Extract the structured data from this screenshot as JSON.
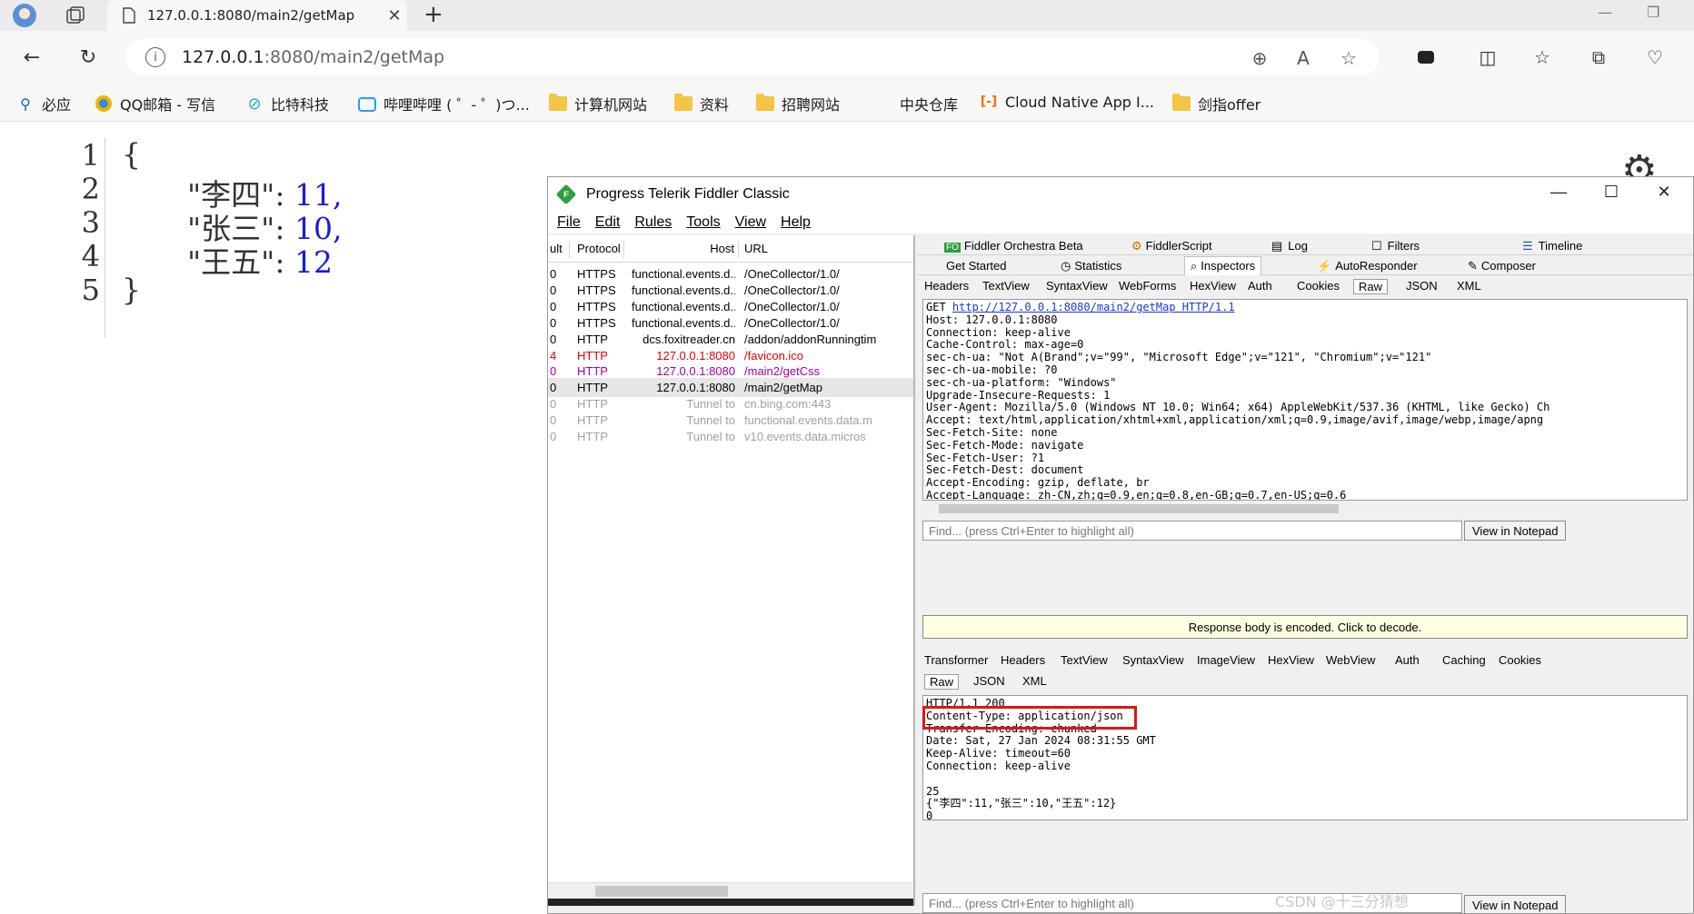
{
  "browser": {
    "tab_title": "127.0.0.1:8080/main2/getMap",
    "url_host": "127.0.0.1",
    "url_rest": ":8080/main2/getMap",
    "bookmarks": [
      "必应",
      "QQ邮箱 - 写信",
      "比特科技",
      "哔哩哔哩 ( ゜- ゜)つ...",
      "计算机网站",
      "资料",
      "招聘网站",
      "中央仓库",
      "Cloud Native App I...",
      "剑指offer"
    ]
  },
  "json_view": {
    "line_numbers": [
      "1",
      "2",
      "3",
      "4",
      "5"
    ],
    "open_brace": "{",
    "close_brace": "}",
    "entries": [
      {
        "key": "\"李四\":",
        "value": "11,"
      },
      {
        "key": "\"张三\":",
        "value": "10,"
      },
      {
        "key": "\"王五\":",
        "value": "12"
      }
    ]
  },
  "fiddler": {
    "title": "Progress Telerik Fiddler Classic",
    "menu": [
      "File",
      "Edit",
      "Rules",
      "Tools",
      "View",
      "Help"
    ],
    "session_headers": {
      "result": "ult",
      "protocol": "Protocol",
      "host": "Host",
      "url": "URL"
    },
    "sessions": [
      {
        "result": "0",
        "protocol": "HTTPS",
        "host": "functional.events.d...",
        "url": "/OneCollector/1.0/",
        "style": "normal"
      },
      {
        "result": "0",
        "protocol": "HTTPS",
        "host": "functional.events.d...",
        "url": "/OneCollector/1.0/",
        "style": "normal"
      },
      {
        "result": "0",
        "protocol": "HTTPS",
        "host": "functional.events.d...",
        "url": "/OneCollector/1.0/",
        "style": "normal"
      },
      {
        "result": "0",
        "protocol": "HTTPS",
        "host": "functional.events.d...",
        "url": "/OneCollector/1.0/",
        "style": "normal"
      },
      {
        "result": "0",
        "protocol": "HTTP",
        "host": "dcs.foxitreader.cn",
        "url": "/addon/addonRunningtim",
        "style": "normal"
      },
      {
        "result": "4",
        "protocol": "HTTP",
        "host": "127.0.0.1:8080",
        "url": "/favicon.ico",
        "style": "red"
      },
      {
        "result": "0",
        "protocol": "HTTP",
        "host": "127.0.0.1:8080",
        "url": "/main2/getCss",
        "style": "purple"
      },
      {
        "result": "0",
        "protocol": "HTTP",
        "host": "127.0.0.1:8080",
        "url": "/main2/getMap",
        "style": "selected"
      },
      {
        "result": "0",
        "protocol": "HTTP",
        "host": "Tunnel to",
        "url": "cn.bing.com:443",
        "style": "gray"
      },
      {
        "result": "0",
        "protocol": "HTTP",
        "host": "Tunnel to",
        "url": "functional.events.data.m",
        "style": "gray"
      },
      {
        "result": "0",
        "protocol": "HTTP",
        "host": "Tunnel to",
        "url": "v10.events.data.micros",
        "style": "gray"
      }
    ],
    "top_tabs_row1": [
      "Fiddler Orchestra Beta",
      "FiddlerScript",
      "Log",
      "Filters",
      "Timeline"
    ],
    "top_tabs_row2": [
      "Get Started",
      "Statistics",
      "Inspectors",
      "AutoResponder",
      "Composer"
    ],
    "request_tabs": [
      "Headers",
      "TextView",
      "SyntaxView",
      "WebForms",
      "HexView",
      "Auth",
      "Cookies",
      "Raw",
      "JSON",
      "XML"
    ],
    "request_raw": {
      "method": "GET ",
      "request_url": "http://127.0.0.1:8080/main2/getMap HTTP/1.1",
      "lines": [
        "Host: 127.0.0.1:8080",
        "Connection: keep-alive",
        "Cache-Control: max-age=0",
        "sec-ch-ua: \"Not A(Brand\";v=\"99\", \"Microsoft Edge\";v=\"121\", \"Chromium\";v=\"121\"",
        "sec-ch-ua-mobile: ?0",
        "sec-ch-ua-platform: \"Windows\"",
        "Upgrade-Insecure-Requests: 1",
        "User-Agent: Mozilla/5.0 (Windows NT 10.0; Win64; x64) AppleWebKit/537.36 (KHTML, like Gecko) Ch",
        "Accept: text/html,application/xhtml+xml,application/xml;q=0.9,image/avif,image/webp,image/apng",
        "Sec-Fetch-Site: none",
        "Sec-Fetch-Mode: navigate",
        "Sec-Fetch-User: ?1",
        "Sec-Fetch-Dest: document",
        "Accept-Encoding: gzip, deflate, br",
        "Accept-Language: zh-CN,zh;q=0.9,en;q=0.8,en-GB;q=0.7,en-US;q=0.6"
      ]
    },
    "find_placeholder": "Find... (press Ctrl+Enter to highlight all)",
    "view_in_notepad": "View in Notepad",
    "encoded_notice": "Response body is encoded. Click to decode.",
    "response_tabs": [
      "Transformer",
      "Headers",
      "TextView",
      "SyntaxView",
      "ImageView",
      "HexView",
      "WebView",
      "Auth",
      "Caching",
      "Cookies"
    ],
    "response_subtabs": [
      "Raw",
      "JSON",
      "XML"
    ],
    "response_raw": [
      "HTTP/1.1 200",
      "Content-Type: application/json",
      "Transfer-Encoding: chunked",
      "Date: Sat, 27 Jan 2024 08:31:55 GMT",
      "Keep-Alive: timeout=60",
      "Connection: keep-alive",
      "",
      "25",
      "{\"李四\":11,\"张三\":10,\"王五\":12}",
      "0"
    ]
  },
  "watermark": "CSDN @十三分猜想"
}
